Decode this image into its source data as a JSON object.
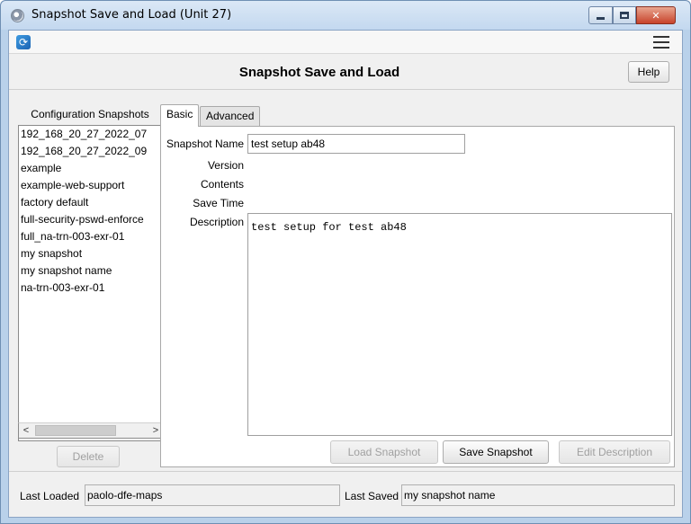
{
  "window": {
    "title": "Snapshot Save and Load (Unit 27)"
  },
  "header": {
    "title": "Snapshot Save and Load",
    "help_label": "Help"
  },
  "snapshots": {
    "label": "Configuration Snapshots",
    "items": [
      "192_168_20_27_2022_07",
      "192_168_20_27_2022_09",
      "example",
      "example-web-support",
      "factory default",
      "full-security-pswd-enforce",
      "full_na-trn-003-exr-01",
      "my snapshot",
      "my snapshot name",
      "na-trn-003-exr-01"
    ],
    "delete_label": "Delete"
  },
  "tabs": {
    "basic": "Basic",
    "advanced": "Advanced"
  },
  "form": {
    "name_label": "Snapshot Name",
    "name_value": "test setup ab48",
    "version_label": "Version",
    "contents_label": "Contents",
    "save_time_label": "Save Time",
    "description_label": "Description",
    "description_value": "test setup for test ab48"
  },
  "actions": {
    "load": "Load Snapshot",
    "save": "Save Snapshot",
    "edit": "Edit Description"
  },
  "footer": {
    "last_loaded_label": "Last Loaded",
    "last_loaded_value": "paolo-dfe-maps",
    "last_saved_label": "Last Saved",
    "last_saved_value": "my snapshot name"
  },
  "icons": {
    "app": "gear-icon",
    "refresh": "refresh-icon",
    "menu": "hamburger-menu-icon"
  }
}
